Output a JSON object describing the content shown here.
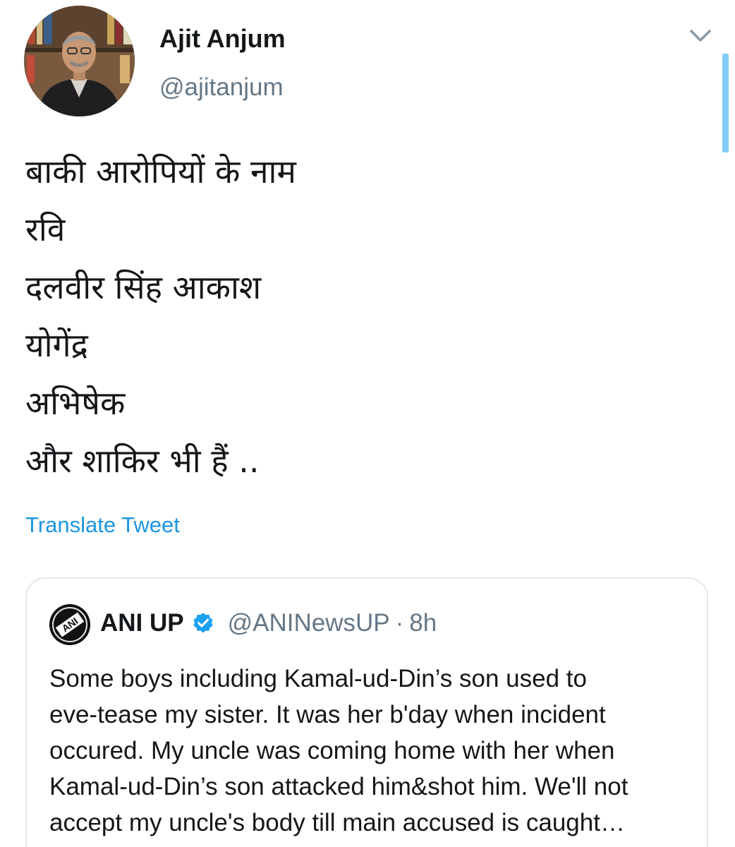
{
  "author": {
    "name": "Ajit Anjum",
    "handle": "@ajitanjum"
  },
  "tweet": {
    "lines": [
      "बाकी आरोपियों के नाम",
      "रवि",
      "दलवीर सिंह आकाश",
      "योगेंद्र",
      "अभिषेक",
      "और शाकिर भी हैं .."
    ],
    "translate_label": "Translate Tweet"
  },
  "quoted": {
    "name": "ANI UP",
    "handle": "@ANINewsUP",
    "separator": "·",
    "time": "8h",
    "text_lines": [
      "Some boys including Kamal-ud-Din’s son used to",
      "eve-tease my sister. It was her b'day when incident",
      "occured. My uncle was coming home with her when",
      "Kamal-ud-Din’s son attacked him&shot him. We'll not",
      "accept my uncle's body till main accused is caught…"
    ],
    "avatar_logo_text": "ANI"
  },
  "icons": {
    "menu": "chevron-down-icon",
    "verified": "verified-badge-icon"
  },
  "colors": {
    "link": "#1b95e0",
    "secondary_text": "#657786",
    "verified": "#1da1f2",
    "border": "#e1e8ed"
  }
}
